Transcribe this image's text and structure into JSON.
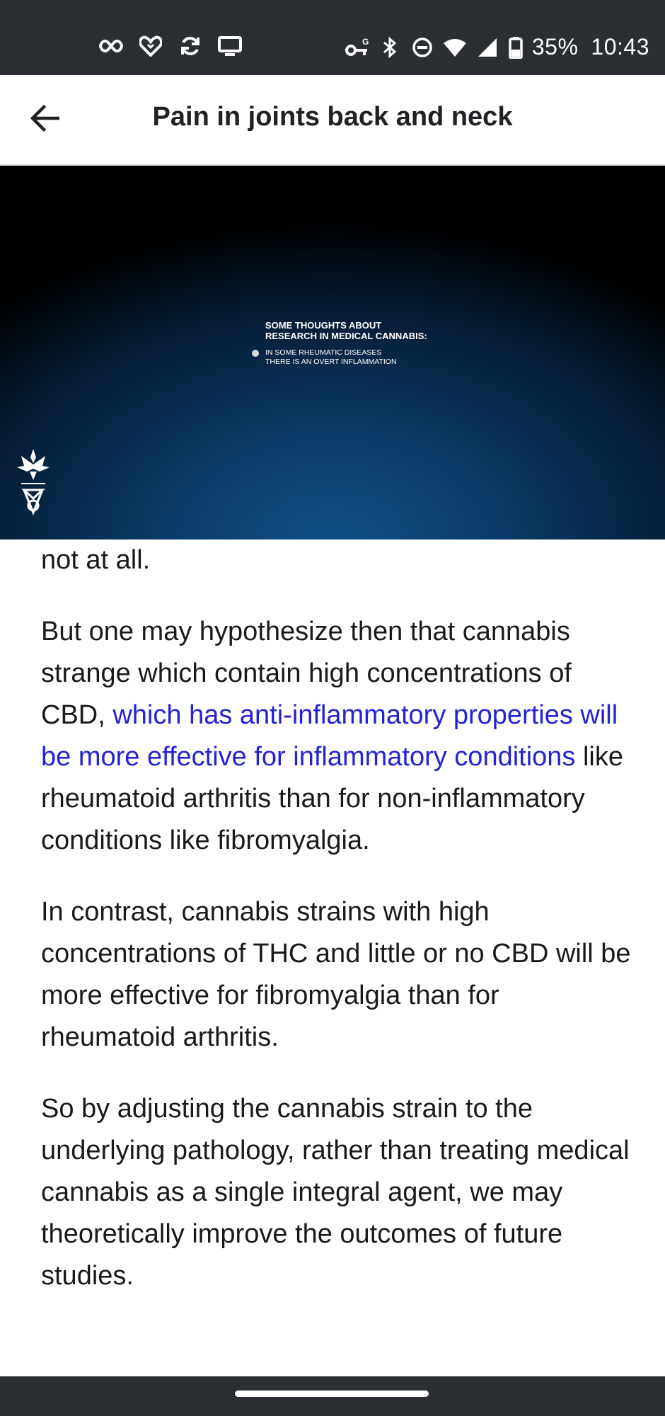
{
  "status_bar": {
    "left_icons": [
      "infinity-icon",
      "heart-icon",
      "sync-icon",
      "cast-screen-icon"
    ],
    "right_icons": [
      "vpn-key-icon",
      "bluetooth-icon",
      "do-not-disturb-icon",
      "wifi-icon",
      "signal-icon",
      "battery-icon"
    ],
    "battery": "35%",
    "time": "10:43"
  },
  "app_bar": {
    "back_icon": "arrow-back-icon",
    "title": "Pain in joints back and neck"
  },
  "video": {
    "slide_heading_line1": "SOME THOUGHTS ABOUT",
    "slide_heading_line2": "RESEARCH IN MEDICAL CANNABIS:",
    "bullet_line1": "IN SOME RHEUMATIC DISEASES",
    "bullet_line2": "THERE IS AN OVERT INFLAMMATION",
    "logo_icon": "university-emblem-icon",
    "colors": {
      "top": "#000000",
      "bottom": "#0f4f86"
    }
  },
  "article": {
    "p1": "not at all.",
    "p2_before": "But one may hypothesize then that cannabis strange which contain high concentrations of CBD, ",
    "p2_highlight": "which has anti-inflammatory properties will be more effective for inflammatory conditions",
    "p2_after": " like rheumatoid arthritis than for non-inflammatory conditions like fibromyalgia.",
    "p3": "In contrast, cannabis strains with high concentrations of THC and little or no CBD will be more effective for fibromyalgia than for rheumatoid arthritis.",
    "p4": "So by adjusting the cannabis strain to the underlying pathology, rather than treating medical cannabis as a single integral agent, we may theoretically improve the outcomes of future studies.",
    "highlight_color": "#2323d6"
  },
  "nav_bar": {
    "home_indicator": "home-pill"
  }
}
